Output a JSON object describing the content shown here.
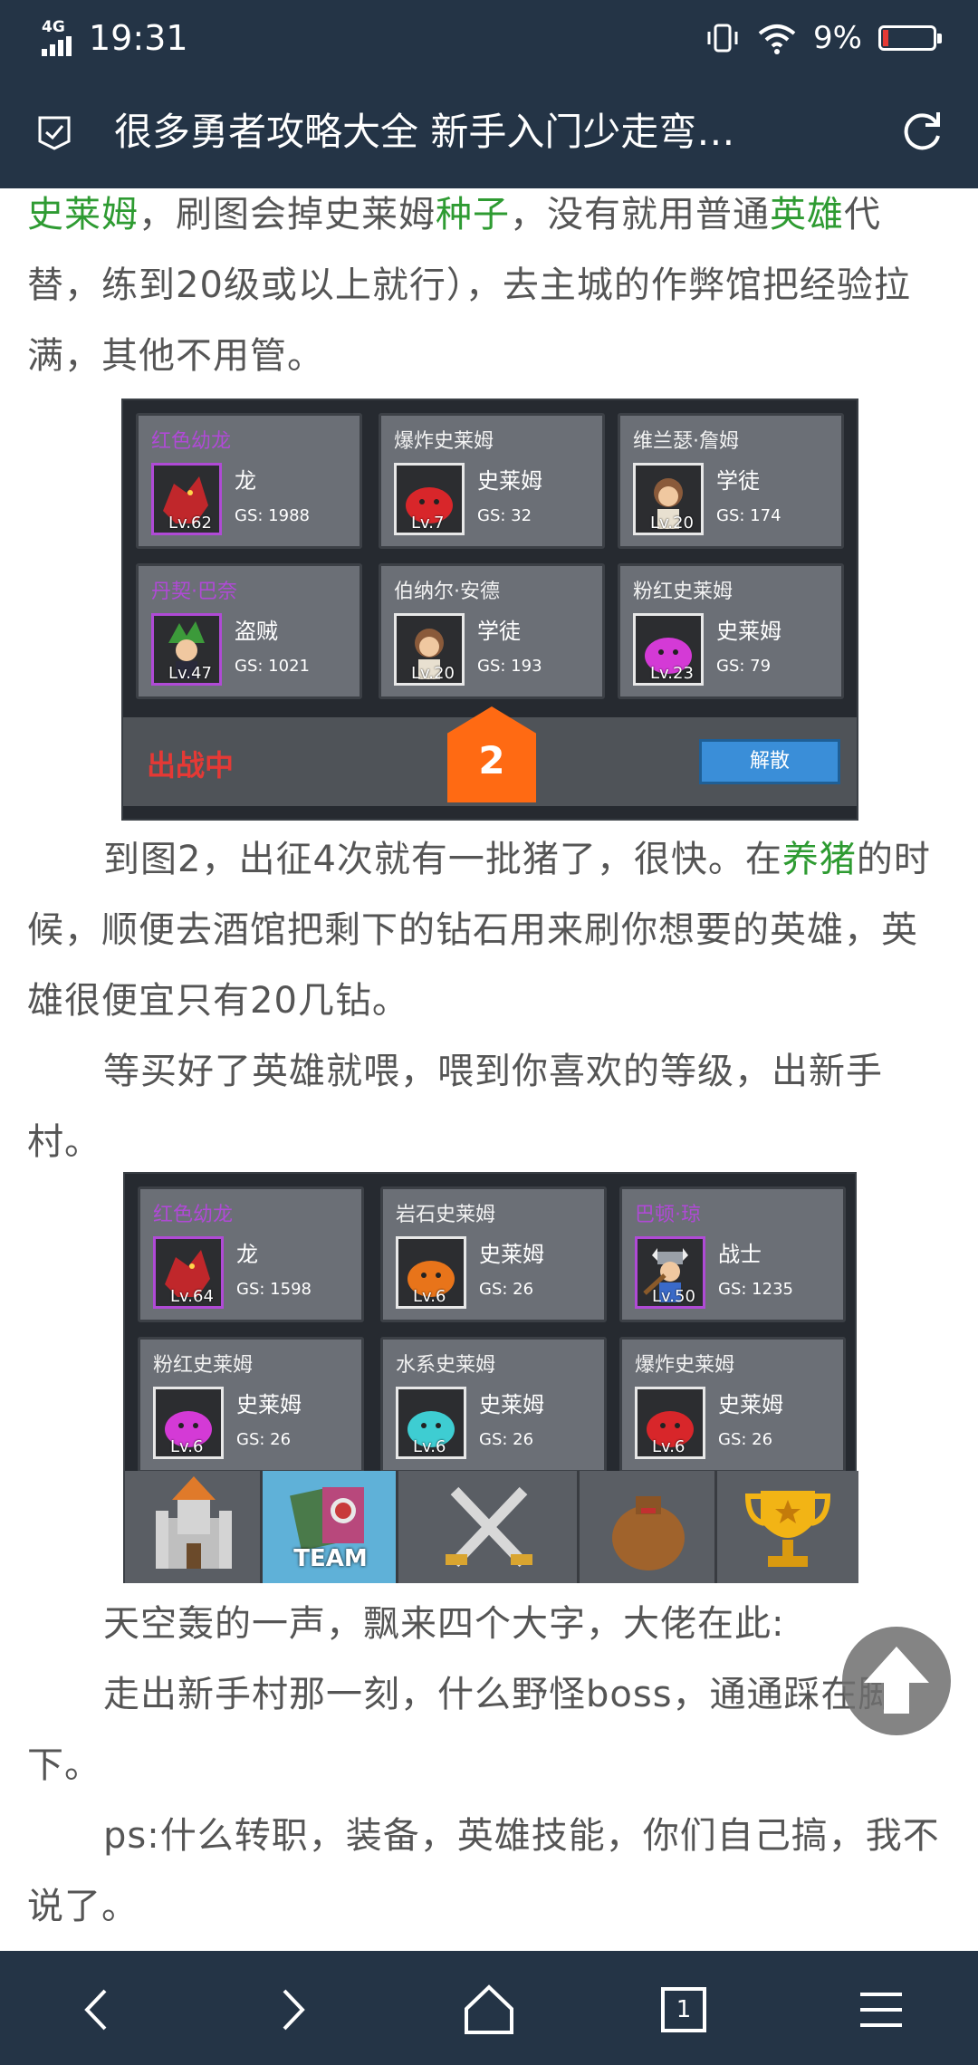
{
  "status_bar": {
    "network": "4G",
    "time": "19:31",
    "battery_percent": "9%",
    "battery_level": 0.09,
    "battery_color": "#e53935"
  },
  "header": {
    "title": "很多勇者攻略大全 新手入门少走弯…",
    "left_icon": "bookmark-check-icon",
    "right_icon": "refresh-icon"
  },
  "article": {
    "para1_a": "史莱姆",
    "para1_b": "，刷图会掉史莱姆",
    "para1_c": "种子",
    "para1_d": "，没有就用普通",
    "para1_e": "英雄",
    "para1_f": "代替，练到20级或以上就行），去主城的作弊馆把经验拉满，其他不用管。",
    "para2_a": "到图2，出征4次就有一批猪了，很快。在",
    "para2_b": "养猪",
    "para2_c": "的时候，顺便去酒馆把剩下的钻石用来刷你想要的英雄，英雄很便宜只有20几钻。",
    "para3": "等买好了英雄就喂，喂到你喜欢的等级，出新手村。",
    "para4": "天空轰的一声，飘来四个大字，大佬在此:",
    "para5": "走出新手村那一刻，什么野怪boss，通通踩在脚下。",
    "para6": "ps:什么转职，装备，英雄技能，你们自己搞，我不说了。",
    "highlight_color": "#2e9b32"
  },
  "screenshot1": {
    "cards": [
      {
        "name": "红色幼龙",
        "class": "龙",
        "level": "Lv.62",
        "gs": "GS: 1988",
        "elite": true,
        "portrait": "red-dragon"
      },
      {
        "name": "爆炸史莱姆",
        "class": "史莱姆",
        "level": "Lv.7",
        "gs": "GS: 32",
        "elite": false,
        "portrait": "red-slime"
      },
      {
        "name": "维兰瑟·詹姆",
        "class": "学徒",
        "level": "Lv.20",
        "gs": "GS: 174",
        "elite": false,
        "portrait": "apprentice"
      },
      {
        "name": "丹契·巴奈",
        "class": "盗贼",
        "level": "Lv.47",
        "gs": "GS: 1021",
        "elite": true,
        "portrait": "green-thief"
      },
      {
        "name": "伯纳尔·安德",
        "class": "学徒",
        "level": "Lv.20",
        "gs": "GS: 193",
        "elite": false,
        "portrait": "apprentice"
      },
      {
        "name": "粉红史莱姆",
        "class": "史莱姆",
        "level": "Lv.23",
        "gs": "GS: 79",
        "elite": false,
        "portrait": "pink-slime"
      }
    ],
    "status": "出战中",
    "team_number": "2",
    "disband_label": "解散"
  },
  "screenshot2": {
    "cards": [
      {
        "name": "红色幼龙",
        "class": "龙",
        "level": "Lv.64",
        "gs": "GS: 1598",
        "elite": true,
        "portrait": "red-dragon"
      },
      {
        "name": "岩石史莱姆",
        "class": "史莱姆",
        "level": "Lv.6",
        "gs": "GS: 26",
        "elite": false,
        "portrait": "orange-slime"
      },
      {
        "name": "巴顿·琼",
        "class": "战士",
        "level": "Lv.50",
        "gs": "GS: 1235",
        "elite": true,
        "portrait": "viking-warrior"
      },
      {
        "name": "粉红史莱姆",
        "class": "史莱姆",
        "level": "Lv.6",
        "gs": "GS: 26",
        "elite": false,
        "portrait": "pink-slime"
      },
      {
        "name": "水系史莱姆",
        "class": "史莱姆",
        "level": "Lv.6",
        "gs": "GS: 26",
        "elite": false,
        "portrait": "cyan-slime"
      },
      {
        "name": "爆炸史莱姆",
        "class": "史莱姆",
        "level": "Lv.6",
        "gs": "GS: 26",
        "elite": false,
        "portrait": "red-slime"
      }
    ],
    "tabs": [
      {
        "icon": "castle-icon"
      },
      {
        "icon": "team-card-icon",
        "label": "TEAM",
        "active": true
      },
      {
        "icon": "crossed-swords-icon"
      },
      {
        "icon": "money-bag-icon"
      },
      {
        "icon": "trophy-icon"
      }
    ]
  },
  "bottom_nav": {
    "tab_count": "1",
    "items": [
      "back-icon",
      "forward-icon",
      "home-icon",
      "tabs-icon",
      "menu-icon"
    ]
  }
}
